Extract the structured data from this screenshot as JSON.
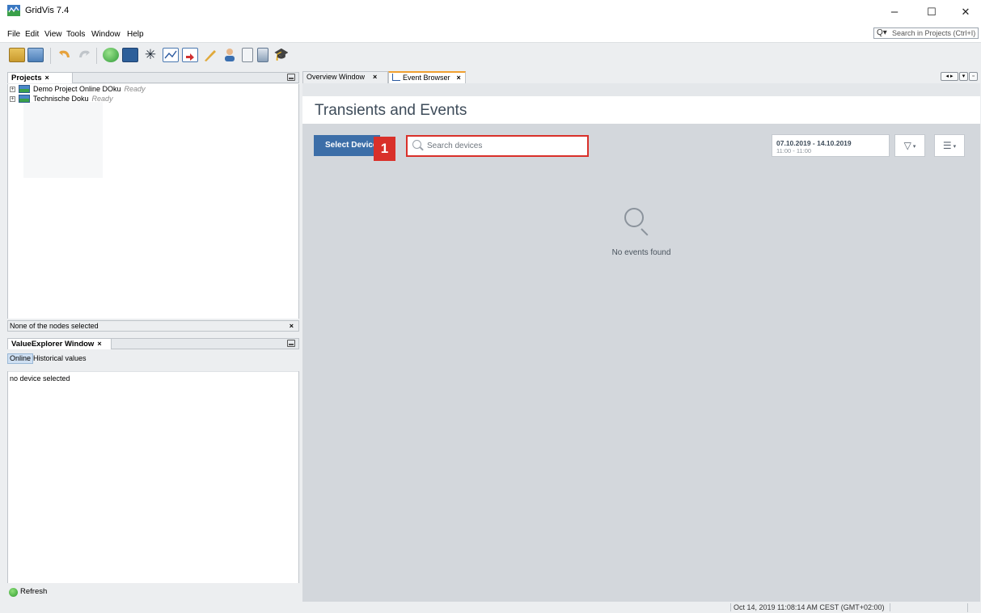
{
  "window": {
    "title": "GridVis 7.4",
    "minimize": "–",
    "maximize": "☐",
    "close": "✕"
  },
  "menu": [
    "File",
    "Edit",
    "View",
    "Tools",
    "Window",
    "Help"
  ],
  "quick_search": {
    "placeholder": "Search in Projects (Ctrl+I)"
  },
  "toolbar_icons": [
    "open-project-icon",
    "save-icon",
    "undo-icon",
    "redo-icon",
    "sync-icon",
    "import-icon",
    "topology-icon",
    "graph-icon",
    "export-icon",
    "tools-icon",
    "users-icon",
    "report-icon",
    "device-icon",
    "academy-icon"
  ],
  "projects": {
    "tab_label": "Projects",
    "close": "×",
    "items": [
      {
        "name": "Demo Project Online DOku",
        "status": "Ready"
      },
      {
        "name": "Technische Doku",
        "status": "Ready"
      }
    ],
    "status_text": "None of the nodes selected",
    "status_close": "×"
  },
  "value_explorer": {
    "tab_label": "ValueExplorer Window",
    "close": "×",
    "tabs": [
      "Online",
      "Historical values"
    ],
    "message": "no device selected",
    "refresh_label": "Refresh"
  },
  "editor": {
    "tabs": [
      {
        "label": "Overview Window",
        "close": "×"
      },
      {
        "label": "Event Browser",
        "close": "×"
      }
    ],
    "page_title": "Transients and Events",
    "select_devices_label": "Select Devices",
    "step_number": "1",
    "search_placeholder": "Search devices",
    "date_range": "07.10.2019 - 14.10.2019",
    "time_range": "11:00 - 11:00",
    "filter_icon": "▽",
    "list_icon": "☰",
    "empty_text": "No events found"
  },
  "status_bar": {
    "clock": "Oct 14, 2019 11:08:14 AM CEST (GMT+02:00)"
  },
  "colors": {
    "accent": "#3c6ea8",
    "highlight": "#d9302a",
    "tab_active": "#f0a030"
  }
}
